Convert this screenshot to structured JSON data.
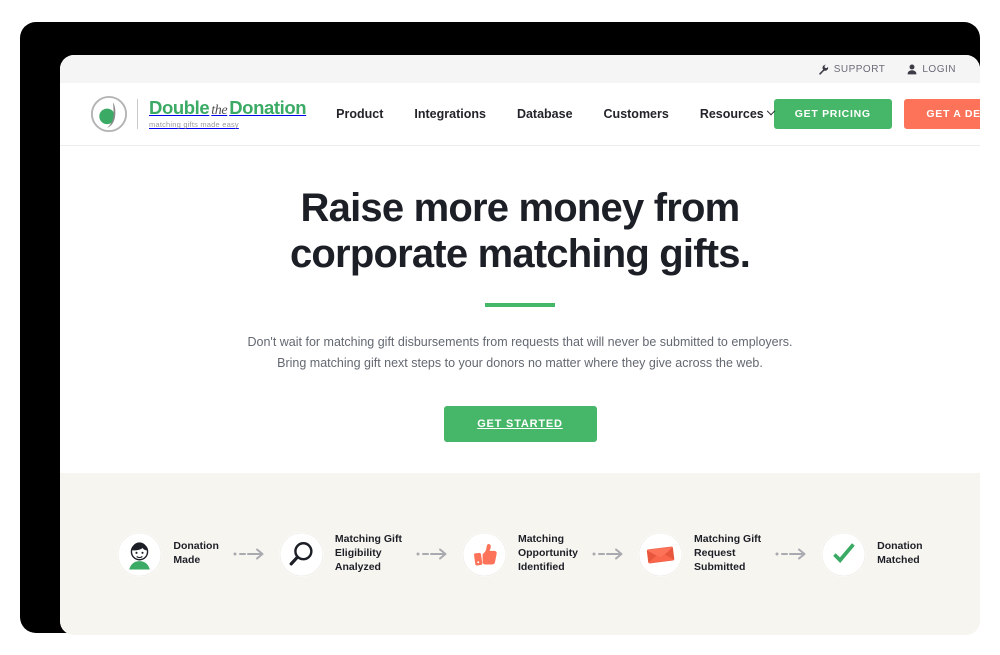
{
  "utility_bar": {
    "links": [
      {
        "label": "SUPPORT",
        "icon": "wrench-icon"
      },
      {
        "label": "LOGIN",
        "icon": "user-icon"
      }
    ]
  },
  "logo": {
    "title_part1": "Double",
    "title_the": "the",
    "title_part2": "Donation",
    "tagline": "matching gifts made easy",
    "icon": "double-the-donation-logo-icon",
    "color": "#3aaa64"
  },
  "nav": {
    "links": [
      {
        "label": "Product",
        "has_chevron": false
      },
      {
        "label": "Integrations",
        "has_chevron": false
      },
      {
        "label": "Database",
        "has_chevron": false
      },
      {
        "label": "Customers",
        "has_chevron": false
      },
      {
        "label": "Resources",
        "has_chevron": true
      }
    ],
    "ctas": [
      {
        "label": "GET PRICING",
        "color": "#46b668"
      },
      {
        "label": "GET A DEMO",
        "color": "#fc7359"
      }
    ]
  },
  "hero": {
    "title_line1": "Raise more money from",
    "title_line2": "corporate matching gifts.",
    "rule_color": "#46b668",
    "subtitle_line1": "Don't wait for matching gift disbursements from requests that will never be submitted to employers.",
    "subtitle_line2": "Bring matching gift next steps to your donors no matter where they give across the web.",
    "cta_label": "GET STARTED"
  },
  "steps": {
    "items": [
      {
        "icon": "donor-avatar-icon",
        "label": "Donation\nMade"
      },
      {
        "icon": "magnifying-glass-icon",
        "label": "Matching Gift\nEligibility\nAnalyzed"
      },
      {
        "icon": "thumbs-up-icon",
        "label": "Matching\nOpportunity\nIdentified"
      },
      {
        "icon": "envelope-icon",
        "label": "Matching Gift\nRequest\nSubmitted"
      },
      {
        "icon": "green-check-icon",
        "label": "Donation\nMatched"
      }
    ],
    "arrow_icon": "dashed-arrow-icon",
    "background": "#f7f5f0"
  }
}
